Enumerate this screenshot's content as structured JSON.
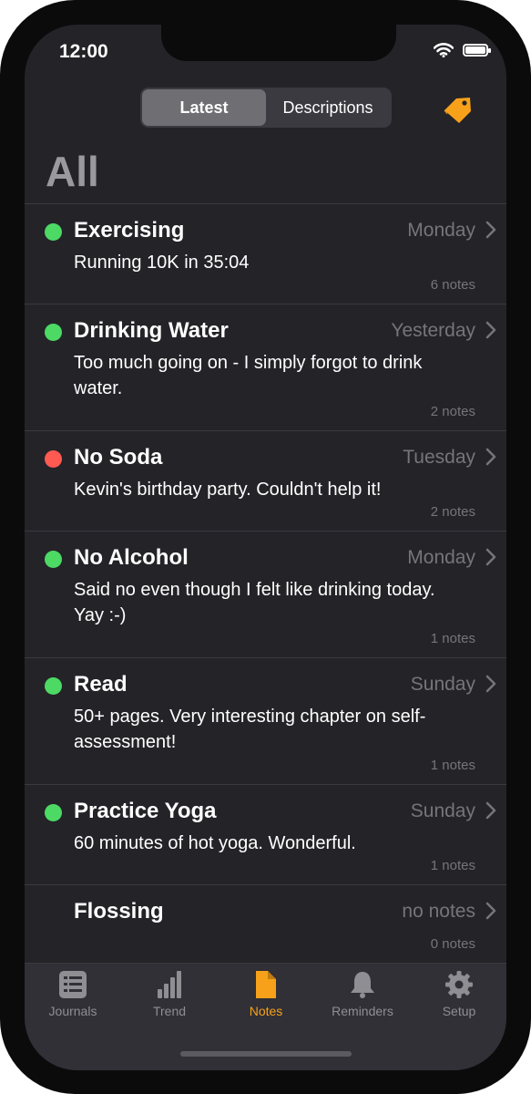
{
  "status": {
    "time": "12:00"
  },
  "segmented": {
    "latest": "Latest",
    "descriptions": "Descriptions"
  },
  "page_title": "All",
  "items": [
    {
      "name": "Exercising",
      "date": "Monday",
      "desc": "Running 10K in 35:04",
      "count": "6 notes",
      "status": "green"
    },
    {
      "name": "Drinking Water",
      "date": "Yesterday",
      "desc": "Too much going on - I simply forgot to drink water.",
      "count": "2 notes",
      "status": "green"
    },
    {
      "name": "No Soda",
      "date": "Tuesday",
      "desc": "Kevin's birthday party. Couldn't help it!",
      "count": "2 notes",
      "status": "red"
    },
    {
      "name": "No Alcohol",
      "date": "Monday",
      "desc": "Said no even though I felt like drinking today. Yay :-)",
      "count": "1 notes",
      "status": "green"
    },
    {
      "name": "Read",
      "date": "Sunday",
      "desc": "50+ pages. Very interesting chapter on self-assessment!",
      "count": "1 notes",
      "status": "green"
    },
    {
      "name": "Practice Yoga",
      "date": "Sunday",
      "desc": "60 minutes of hot yoga. Wonderful.",
      "count": "1 notes",
      "status": "green"
    },
    {
      "name": "Flossing",
      "date": "no notes",
      "desc": "",
      "count": "0 notes",
      "status": "none"
    }
  ],
  "colors": {
    "green": "#4cd964",
    "red": "#ff5a52",
    "accent": "#f7a11a"
  },
  "tabs": [
    {
      "label": "Journals",
      "icon": "list-icon",
      "active": false
    },
    {
      "label": "Trend",
      "icon": "bars-icon",
      "active": false
    },
    {
      "label": "Notes",
      "icon": "document-icon",
      "active": true
    },
    {
      "label": "Reminders",
      "icon": "bell-icon",
      "active": false
    },
    {
      "label": "Setup",
      "icon": "gear-icon",
      "active": false
    }
  ]
}
